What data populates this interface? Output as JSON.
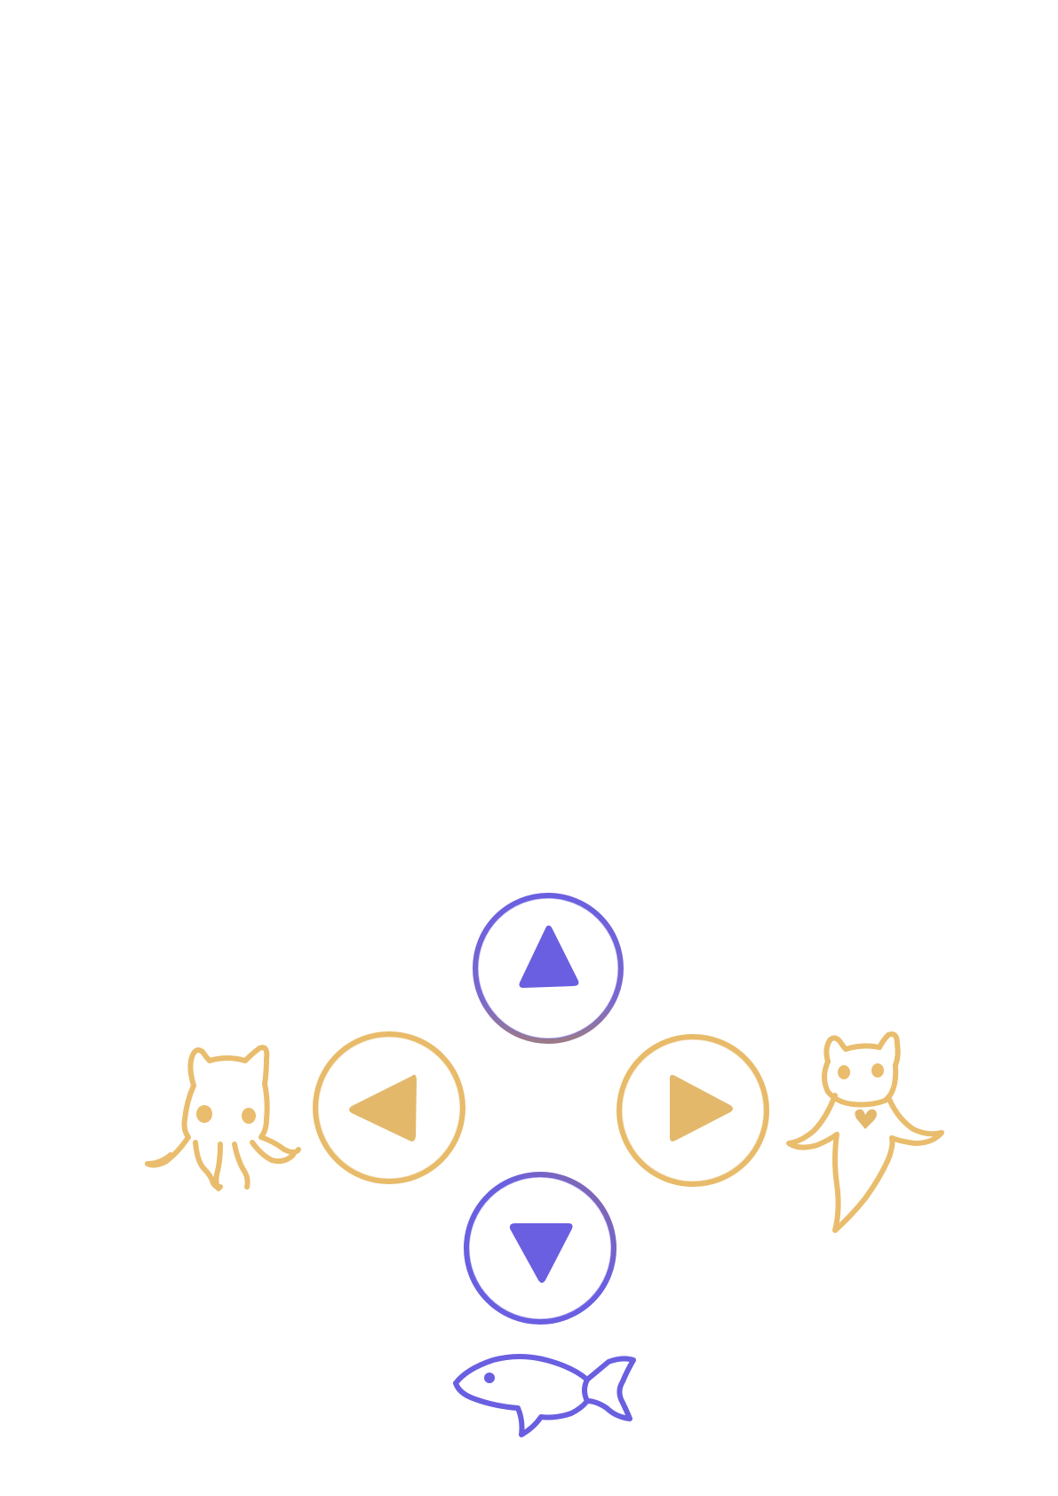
{
  "controls": {
    "up": {
      "icon": "triangle-up-icon",
      "color": "#6a5fe0",
      "ring_color": "#6a5fe0",
      "ring_accent": "#9a7a8a"
    },
    "down": {
      "icon": "triangle-down-icon",
      "color": "#6a5fe0",
      "ring_color": "#6a5fe0",
      "ring_accent": "#8a6aa0"
    },
    "left": {
      "icon": "triangle-left-icon",
      "color": "#e3b86b",
      "ring_color": "#e8bb6a"
    },
    "right": {
      "icon": "triangle-right-icon",
      "color": "#e3b86b",
      "ring_color": "#e8bb6a"
    }
  },
  "characters": {
    "left": {
      "icon": "octopus-icon",
      "color": "#e9bd6d"
    },
    "right": {
      "icon": "ghost-cat-icon",
      "color": "#e9bd6d",
      "accent": "#e3b86b"
    },
    "bottom": {
      "icon": "fish-icon",
      "color": "#6a5fe0"
    }
  },
  "palette": {
    "background": "#ffffff",
    "purple": "#6a5fe0",
    "gold": "#e6b96b"
  }
}
